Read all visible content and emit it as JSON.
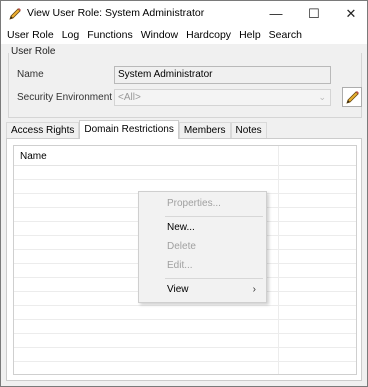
{
  "window": {
    "title": "View User Role: System Administrator",
    "controls": {
      "minimize": "—",
      "maximize": "☐",
      "close": "✕"
    }
  },
  "menubar": [
    "User Role",
    "Log",
    "Functions",
    "Window",
    "Hardcopy",
    "Help",
    "Search"
  ],
  "user_role_group": {
    "label": "User Role",
    "name_label": "Name",
    "name_value": "System Administrator",
    "security_env_label": "Security Environment",
    "security_env_value": "<All>",
    "edit_icon": "pencil-icon"
  },
  "tabs": [
    {
      "label": "Access Rights",
      "active": false
    },
    {
      "label": "Domain Restrictions",
      "active": true
    },
    {
      "label": "Members",
      "active": false
    },
    {
      "label": "Notes",
      "active": false
    }
  ],
  "list": {
    "columns": [
      "Name"
    ]
  },
  "context_menu": {
    "properties": "Properties...",
    "new": "New...",
    "delete": "Delete",
    "edit": "Edit...",
    "view": "View",
    "submenu_arrow": "›"
  },
  "colors": {
    "window_bg": "#f0f0f0",
    "disabled_text": "#a0a0a0",
    "pencil_body": "#e8b030"
  }
}
